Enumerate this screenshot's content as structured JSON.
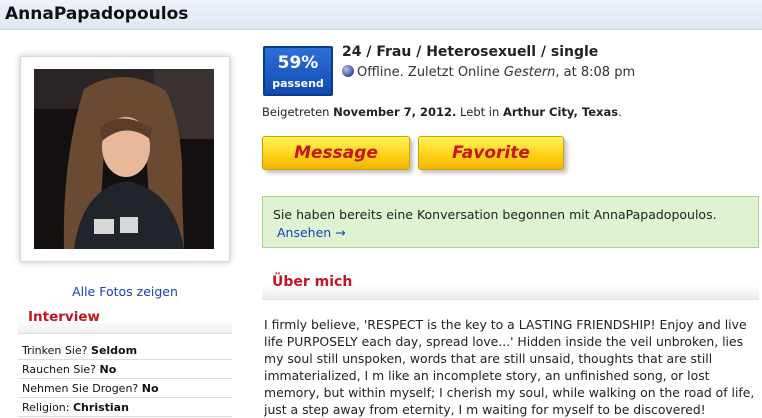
{
  "profile": {
    "username": "AnnaPapadopoulos",
    "all_photos_label": "Alle Fotos zeigen",
    "match": {
      "percent": "59%",
      "label": "passend"
    },
    "summary": "24 / Frau / Heterosexuell / single",
    "status": {
      "icon": "status-dot-icon",
      "prefix": "Offline. Zuletzt Online ",
      "when": "Gestern",
      "suffix": ", at 8:08 pm"
    },
    "joined": {
      "label": "Beigetreten ",
      "date": "November 7, 2012.",
      "lives_label": " Lebt in ",
      "location": "Arthur City, Texas",
      "end": "."
    }
  },
  "buttons": {
    "message": "Message",
    "favorite": "Favorite"
  },
  "conversation": {
    "text": "Sie haben bereits eine Konversation begonnen mit AnnaPapadopoulos.",
    "link": "Ansehen →"
  },
  "about": {
    "heading": "Über mich",
    "text": "I firmly believe, 'RESPECT is the key to a LASTING FRIENDSHIP! Enjoy and live life PURPOSELY each day, spread love...' Hidden inside the veil unbroken, lies my soul still unspoken, words that are still unsaid, thoughts that are still immaterialized, I m like an incomplete story, an unfinished song, or lost memory, but within myself; I cherish my soul, while walking on the road of life, just a step away from eternity, I m waiting for myself to be discovered!"
  },
  "interview": {
    "heading": "Interview",
    "items": [
      {
        "question": "Trinken Sie? ",
        "answer": "Seldom"
      },
      {
        "question": "Rauchen Sie? ",
        "answer": "No"
      },
      {
        "question": "Nehmen Sie Drogen? ",
        "answer": "No"
      },
      {
        "question": "Religion: ",
        "answer": "Christian"
      }
    ]
  },
  "colors": {
    "section_heading": "#c0161d",
    "link": "#1a3fb8",
    "match_badge": "#1a55c0",
    "button_text": "#c81414",
    "conversation_bg": "#dff3d2"
  }
}
